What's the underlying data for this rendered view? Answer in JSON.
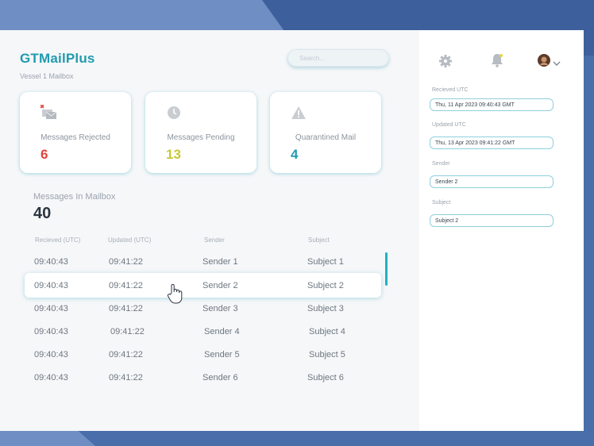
{
  "app": {
    "title": "GTMailPlus",
    "subtitle": "Vessel 1 Mailbox"
  },
  "search": {
    "placeholder": "Search..."
  },
  "stats": {
    "rejected": {
      "label": "Messages Rejected",
      "value": "6",
      "color": "#e0443a"
    },
    "pending": {
      "label": "Messages Pending",
      "value": "13",
      "color": "#c7c936"
    },
    "quarantined": {
      "label": "Quarantined Mail",
      "value": "4",
      "color": "#1f9bb0"
    }
  },
  "mailbox": {
    "label": "Messages In Mailbox",
    "count": "40"
  },
  "table": {
    "headers": [
      "Recieved (UTC)",
      "Updated (UTC)",
      "Sender",
      "Subject"
    ],
    "rows": [
      {
        "received": "09:40:43",
        "updated": "09:41:22",
        "sender": "Sender 1",
        "subject": "Subject 1"
      },
      {
        "received": "09:40:43",
        "updated": "09:41:22",
        "sender": "Sender 2",
        "subject": "Subject 2"
      },
      {
        "received": "09:40:43",
        "updated": "09:41:22",
        "sender": "Sender 3",
        "subject": "Subject 3"
      },
      {
        "received": "09:40:43",
        "updated": "09:41:22",
        "sender": "Sender 4",
        "subject": "Subject 4"
      },
      {
        "received": "09:40:43",
        "updated": "09:41:22",
        "sender": "Sender 5",
        "subject": "Subject 5"
      },
      {
        "received": "09:40:43",
        "updated": "09:41:22",
        "sender": "Sender 6",
        "subject": "Subject 6"
      }
    ],
    "selected_index": 1
  },
  "details": {
    "received_label": "Recieved UTC",
    "received_value": "Thu, 11 Apr 2023 09:40:43 GMT",
    "updated_label": "Updated UTC",
    "updated_value": "Thu, 13 Apr 2023 09:41:22 GMT",
    "sender_label": "Sender",
    "sender_value": "Sender 2",
    "subject_label": "Subject",
    "subject_value": "Subject 2"
  },
  "icons": {
    "settings": "gear-icon",
    "notifications": "bell-icon",
    "user": "avatar",
    "menu": "chevron-down-icon",
    "cursor": "hand-pointer-icon"
  },
  "colors": {
    "accent": "#1f9bb0",
    "frame": "#4a6ea9"
  }
}
